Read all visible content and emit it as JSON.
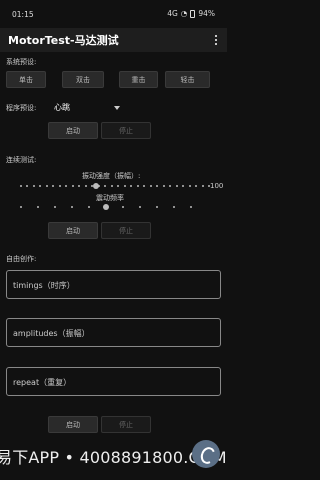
{
  "status_bar": {
    "time": "01:15",
    "network": "4G",
    "battery": "94%"
  },
  "app": {
    "title": "MotorTest-马达测试"
  },
  "preset": {
    "label": "系统预设:",
    "buttons": [
      "单击",
      "双击",
      "重击",
      "轻击"
    ]
  },
  "program": {
    "label": "程序预设:",
    "selected": "心跳",
    "start": "启动",
    "stop": "停止"
  },
  "continuous": {
    "label": "连续测试:",
    "amplitude_label": "振动强度（振幅）:",
    "amplitude_value": "100",
    "amplitude_level": 0.4,
    "frequency_label": "震动频率",
    "frequency_level": 0.5,
    "start": "启动",
    "stop": "停止"
  },
  "custom": {
    "label": "自由创作:",
    "timings_placeholder": "timings（时序）",
    "amplitudes_placeholder": "amplitudes（振幅）",
    "repeat_placeholder": "repeat（重复）",
    "start": "启动",
    "stop": "停止"
  },
  "watermark": {
    "text": "易下APP • 4008891800.COM"
  }
}
